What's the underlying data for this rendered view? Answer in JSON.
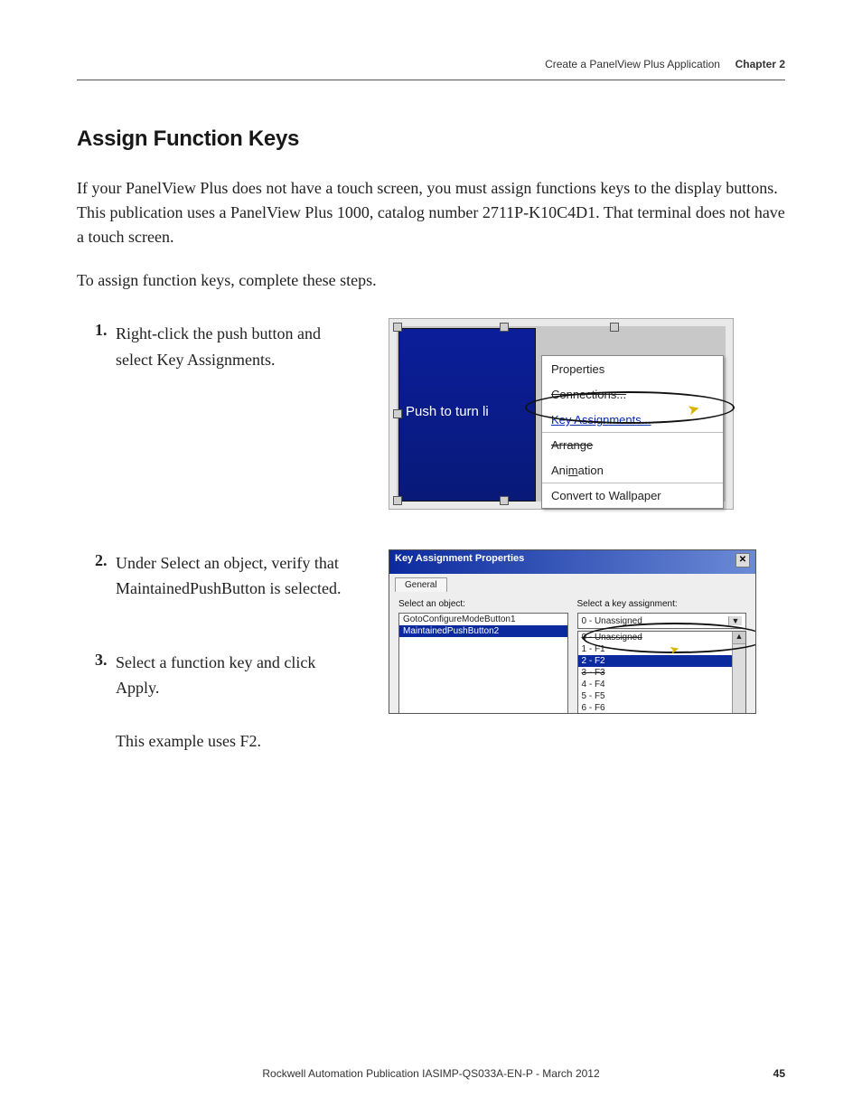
{
  "header": {
    "breadcrumb": "Create a PanelView Plus Application",
    "chapter_label": "Chapter 2"
  },
  "title": "Assign Function Keys",
  "intro": "If your PanelView Plus does not have a touch screen, you must assign functions keys to the display buttons. This publication uses a PanelView Plus 1000, catalog number 2711P-K10C4D1. That terminal does not have a touch screen.",
  "lead": "To assign function keys, complete these steps.",
  "steps": {
    "s1": {
      "num": "1.",
      "text": "Right-click the push button and select Key Assignments."
    },
    "s2": {
      "num": "2.",
      "text": "Under Select an object, verify that MaintainedPushButton is selected."
    },
    "s3": {
      "num": "3.",
      "text": "Select a function key and click Apply.",
      "note": "This example uses F2."
    }
  },
  "fig1": {
    "button_label": "Push to turn li",
    "menu": {
      "properties": "Properties",
      "connections": "Connections...",
      "key_assignments": "Key Assignments...",
      "arrange": "Arrange",
      "animation": "Animation",
      "convert": "Convert to Wallpaper"
    }
  },
  "fig2": {
    "title": "Key Assignment Properties",
    "tab": "General",
    "left_label": "Select an object:",
    "right_label": "Select a key assignment:",
    "objects": {
      "o1": "GotoConfigureModeButton1",
      "o2": "MaintainedPushButton2"
    },
    "combo": "0 - Unassigned",
    "keys": {
      "k0": "0 - Unassigned",
      "k1": "1 - F1",
      "k2": "2 - F2",
      "k3": "3 - F3",
      "k4": "4 - F4",
      "k5": "5 - F5",
      "k6": "6 - F6"
    }
  },
  "footer": "Rockwell Automation Publication IASIMP-QS033A-EN-P - March 2012",
  "page_num": "45"
}
